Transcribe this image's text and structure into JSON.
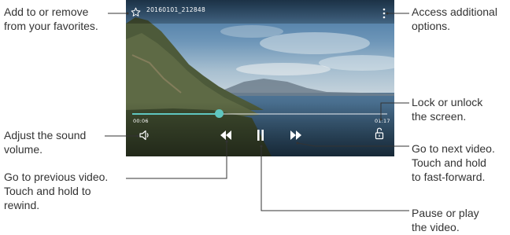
{
  "video": {
    "filename": "20160101_212848",
    "elapsed_time": "00:06",
    "total_time": "01:17",
    "progress_fraction": 0.34
  },
  "callouts": {
    "favorites": [
      "Add to or remove",
      "from your favorites."
    ],
    "options": [
      "Access additional",
      "options."
    ],
    "lock": [
      "Lock or unlock",
      "the screen."
    ],
    "volume": [
      "Adjust the sound",
      "volume."
    ],
    "previous": [
      "Go to previous video.",
      "Touch and hold to",
      "rewind."
    ],
    "next": [
      "Go to next video.",
      "Touch and hold",
      "to fast-forward."
    ],
    "pause": [
      "Pause or play",
      "the video."
    ]
  },
  "icons": {
    "favorite": "star-outline-icon",
    "more": "more-vertical-icon",
    "lock": "lock-open-icon",
    "volume": "volume-icon",
    "rewind": "rewind-icon",
    "pause": "pause-icon",
    "forward": "fast-forward-icon"
  },
  "colors": {
    "seekbar": "#5fc6c0",
    "callout_line": "#333333"
  }
}
